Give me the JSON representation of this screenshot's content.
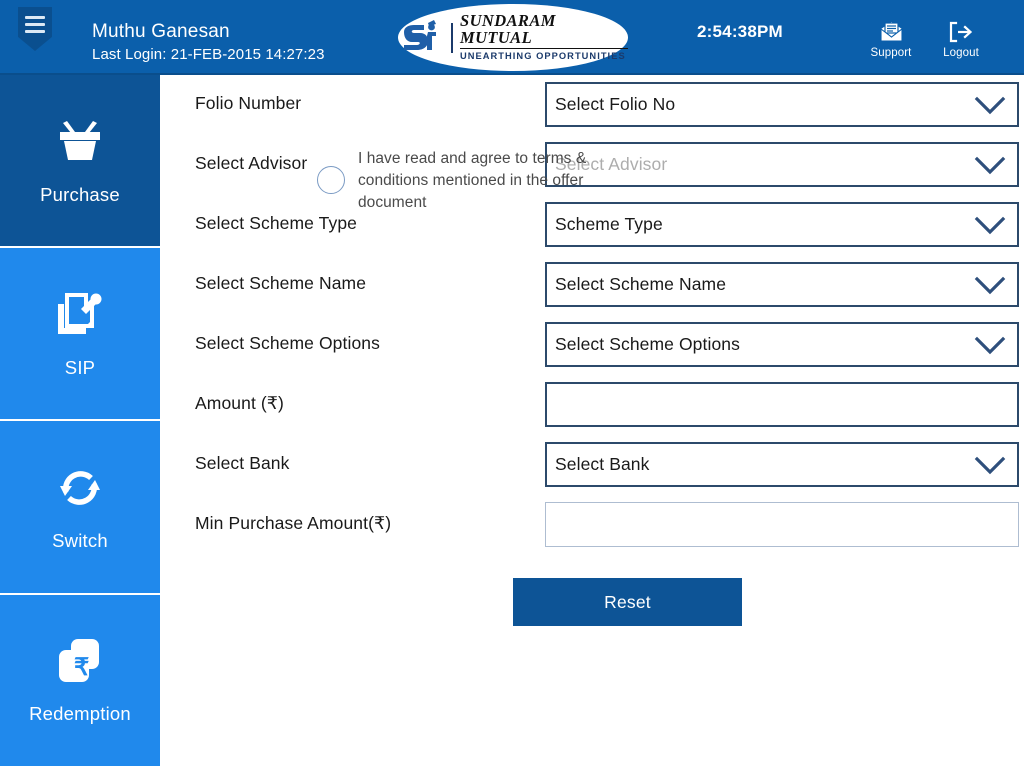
{
  "header": {
    "menu_icon": "hamburger-menu-icon",
    "user_name": "Muthu Ganesan",
    "last_login": "Last Login: 21-FEB-2015 14:27:23",
    "logo": {
      "monogram": "sf",
      "title": "SUNDARAM MUTUAL",
      "tagline": "UNEARTHING OPPORTUNITIES"
    },
    "time": "2:54:38PM",
    "actions": [
      {
        "icon": "envelope-icon",
        "label": "Support"
      },
      {
        "icon": "logout-icon",
        "label": "Logout"
      }
    ],
    "bg_color": "#0b5fab"
  },
  "sidebar": {
    "active_color": "#0d5496",
    "inactive_color": "#2089ec",
    "items": [
      {
        "label": "Purchase",
        "icon": "shopping-basket-icon",
        "active": true
      },
      {
        "label": "SIP",
        "icon": "document-pen-icon",
        "active": false
      },
      {
        "label": "Switch",
        "icon": "refresh-arrows-icon",
        "active": false
      },
      {
        "label": "Redemption",
        "icon": "rupee-cards-icon",
        "active": false
      }
    ]
  },
  "form": {
    "rows": [
      {
        "label": "Folio Number",
        "value": "Select Folio No",
        "type": "dropdown",
        "muted": false
      },
      {
        "label": "Select Advisor",
        "value": "Select Advisor",
        "type": "dropdown",
        "muted": true
      },
      {
        "label": "Select Scheme Type",
        "value": "Scheme Type",
        "type": "dropdown",
        "muted": false
      },
      {
        "label": "Select Scheme Name",
        "value": "Select Scheme Name",
        "type": "dropdown",
        "muted": false
      },
      {
        "label": "Select Scheme Options",
        "value": "Select Scheme Options",
        "type": "dropdown",
        "muted": false
      },
      {
        "label": "Amount (₹)",
        "value": "",
        "type": "text",
        "muted": false
      },
      {
        "label": "Select Bank",
        "value": "Select Bank",
        "type": "dropdown",
        "muted": false
      },
      {
        "label": "Min Purchase Amount(₹)",
        "value": "",
        "type": "text-soft",
        "muted": false
      }
    ],
    "terms_text": "I have read and agree to terms & conditions mentioned in the offer document",
    "terms_checked": false,
    "reset_label": "Reset",
    "reset_color": "#0d5496",
    "field_border_color": "#2c4a6b"
  }
}
